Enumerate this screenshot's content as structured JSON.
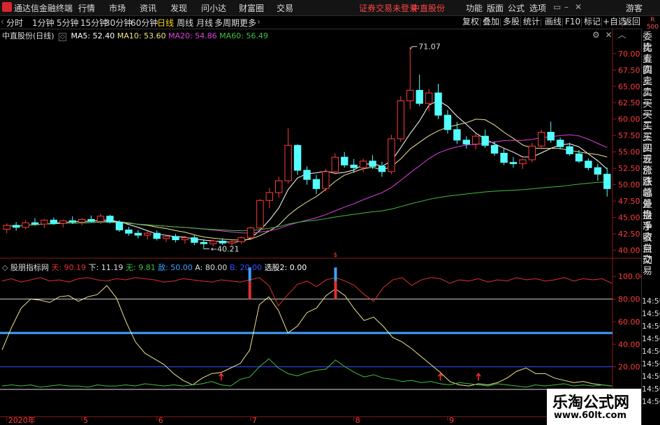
{
  "menubar": {
    "app_title": "通达信金融终端",
    "items": [
      "行情",
      "市场",
      "资讯",
      "发现",
      "问小达",
      "财富圈",
      "交易"
    ],
    "notice": "证券交易未登录",
    "stock_name": "中直股份",
    "right_items": [
      "功能",
      "版面",
      "公式",
      "选项"
    ],
    "guest": "游客"
  },
  "toolbar": {
    "periods": [
      "分时",
      "1分钟",
      "5分钟",
      "15分钟",
      "30分钟",
      "60分钟",
      "日线",
      "周线",
      "月线",
      "多周期",
      "更多"
    ],
    "active_period": "日线",
    "right_items": [
      "复权",
      "叠加",
      "多股",
      "统计",
      "画线",
      "F10",
      "标记",
      "+自选",
      "返回"
    ],
    "r_label": "R",
    "r_value": "500"
  },
  "main_legend": {
    "title": "中直股份(日线)",
    "ma": [
      {
        "label": "MA5: 52.40",
        "color": "#ffffff"
      },
      {
        "label": "MA10: 53.60",
        "color": "#f0e68c"
      },
      {
        "label": "MA20: 54.86",
        "color": "#e040e0"
      },
      {
        "label": "MA60: 56.49",
        "color": "#40c040"
      }
    ]
  },
  "sub_legend": {
    "title": "股朋指标网",
    "items": [
      {
        "label": "天: 90.19",
        "color": "#e03030"
      },
      {
        "label": "下: 11.19",
        "color": "#f0e68c"
      },
      {
        "label": "无: 9.81",
        "color": "#40c040"
      },
      {
        "label": "敌: 50.00",
        "color": "#40a0ff"
      },
      {
        "label": "A: 80.00",
        "color": "#dddddd"
      },
      {
        "label": "B: 20.00",
        "color": "#3050ff"
      },
      {
        "label": "选股2: 0.00",
        "color": "#ffffff"
      }
    ]
  },
  "sidebar": {
    "labels": [
      "委比",
      "卖五",
      "卖四",
      "卖三",
      "卖二",
      "卖一",
      "买一",
      "买二",
      "买三",
      "买四",
      "买五",
      "现价",
      "涨跌",
      "涨幅",
      "总量",
      "外盘",
      "换手",
      "净资",
      "收益",
      "自动",
      "交易"
    ],
    "times": [
      "14:56",
      "14:56",
      "14:56",
      "14:56",
      "14:56",
      "14:56",
      "14:56",
      "14:56",
      "14:56"
    ]
  },
  "chart_data": [
    {
      "type": "candlestick",
      "title": "中直股份(日线)",
      "ylim": [
        39,
        72
      ],
      "yticks": [
        "70.00",
        "67.50",
        "65.00",
        "62.50",
        "60.00",
        "57.50",
        "55.00",
        "52.50",
        "50.00",
        "47.50",
        "45.00",
        "42.50",
        "40.00"
      ],
      "annotations": [
        {
          "label": "71.07",
          "value": 71.07
        },
        {
          "label": "40.21",
          "value": 40.21
        }
      ],
      "candles": [
        [
          43.2,
          44.1,
          42.6,
          43.8
        ],
        [
          43.8,
          44.3,
          43.0,
          43.5
        ],
        [
          43.5,
          44.6,
          43.2,
          44.2
        ],
        [
          44.2,
          44.9,
          43.8,
          44.0
        ],
        [
          44.0,
          44.8,
          43.4,
          44.6
        ],
        [
          44.6,
          45.0,
          43.9,
          44.1
        ],
        [
          44.1,
          44.7,
          43.5,
          44.5
        ],
        [
          44.5,
          45.2,
          44.0,
          44.3
        ],
        [
          44.3,
          44.9,
          43.8,
          44.7
        ],
        [
          44.7,
          45.3,
          44.2,
          44.4
        ],
        [
          44.4,
          45.6,
          44.0,
          45.2
        ],
        [
          45.2,
          45.4,
          44.1,
          44.3
        ],
        [
          44.3,
          44.6,
          42.8,
          43.1
        ],
        [
          43.1,
          43.6,
          42.2,
          42.6
        ],
        [
          42.6,
          43.1,
          41.8,
          42.3
        ],
        [
          42.3,
          42.9,
          41.6,
          42.6
        ],
        [
          42.6,
          43.0,
          41.5,
          41.8
        ],
        [
          41.8,
          42.4,
          41.3,
          42.1
        ],
        [
          42.1,
          42.5,
          41.2,
          41.6
        ],
        [
          41.6,
          42.2,
          41.0,
          41.9
        ],
        [
          41.9,
          42.3,
          40.8,
          41.2
        ],
        [
          41.2,
          41.7,
          40.21,
          41.0
        ],
        [
          41.0,
          41.6,
          40.6,
          41.4
        ],
        [
          41.4,
          41.8,
          40.8,
          41.1
        ],
        [
          41.1,
          41.6,
          40.7,
          41.3
        ],
        [
          41.3,
          42.1,
          41.0,
          41.9
        ],
        [
          41.9,
          43.6,
          41.7,
          43.4
        ],
        [
          43.4,
          47.8,
          43.2,
          47.6
        ],
        [
          47.6,
          49.5,
          46.4,
          48.8
        ],
        [
          48.8,
          51.2,
          48.0,
          50.6
        ],
        [
          50.6,
          58.6,
          50.2,
          56.0
        ],
        [
          56.0,
          56.2,
          51.5,
          52.2
        ],
        [
          52.2,
          52.8,
          50.0,
          50.8
        ],
        [
          50.8,
          51.5,
          48.6,
          49.4
        ],
        [
          49.4,
          52.4,
          49.0,
          52.0
        ],
        [
          52.0,
          54.8,
          51.6,
          54.2
        ],
        [
          54.2,
          55.0,
          52.6,
          53.0
        ],
        [
          53.0,
          53.9,
          51.8,
          52.6
        ],
        [
          52.6,
          54.0,
          51.9,
          53.6
        ],
        [
          53.6,
          54.5,
          52.4,
          52.8
        ],
        [
          52.8,
          53.5,
          51.2,
          52.0
        ],
        [
          52.0,
          57.6,
          51.6,
          57.0
        ],
        [
          57.0,
          63.5,
          56.5,
          62.8
        ],
        [
          62.8,
          71.07,
          61.5,
          64.4
        ],
        [
          64.4,
          66.8,
          62.0,
          62.4
        ],
        [
          62.4,
          64.6,
          61.2,
          64.0
        ],
        [
          64.0,
          65.4,
          60.0,
          60.6
        ],
        [
          60.6,
          61.4,
          57.8,
          58.4
        ],
        [
          58.4,
          59.6,
          56.2,
          56.8
        ],
        [
          56.8,
          57.4,
          55.5,
          56.2
        ],
        [
          56.2,
          57.8,
          55.4,
          57.4
        ],
        [
          57.4,
          58.4,
          55.6,
          56.0
        ],
        [
          56.0,
          56.6,
          54.4,
          54.8
        ],
        [
          54.8,
          55.6,
          53.0,
          53.4
        ],
        [
          53.4,
          54.2,
          52.6,
          53.2
        ],
        [
          53.2,
          54.0,
          52.4,
          53.8
        ],
        [
          53.8,
          56.4,
          53.4,
          55.9
        ],
        [
          55.9,
          58.4,
          55.4,
          58.0
        ],
        [
          58.0,
          59.6,
          56.4,
          56.8
        ],
        [
          56.8,
          57.2,
          55.4,
          55.8
        ],
        [
          55.8,
          56.4,
          54.4,
          54.7
        ],
        [
          54.7,
          55.3,
          53.3,
          53.6
        ],
        [
          53.6,
          54.0,
          52.2,
          52.6
        ],
        [
          52.6,
          53.2,
          50.6,
          51.6
        ],
        [
          51.6,
          52.6,
          48.2,
          49.4
        ]
      ]
    },
    {
      "type": "line",
      "title": "股朋指标网",
      "ylim": [
        0,
        110
      ],
      "yticks": [
        "100.00",
        "80.00",
        "60.00",
        "40.00",
        "20.00"
      ],
      "hlines": [
        {
          "name": "敌",
          "value": 50
        },
        {
          "name": "A",
          "value": 80
        },
        {
          "name": "B",
          "value": 20
        },
        {
          "name": "base",
          "value": 0
        }
      ],
      "series": [
        {
          "name": "天",
          "values": [
            96,
            98,
            95,
            97,
            99,
            96,
            97,
            95,
            98,
            99,
            97,
            96,
            98,
            97,
            99,
            98,
            97,
            95,
            96,
            98,
            97,
            96,
            95,
            97,
            96,
            95,
            97,
            99,
            92,
            74,
            84,
            93,
            96,
            91,
            97,
            99,
            96,
            92,
            84,
            78,
            90,
            97,
            99,
            92,
            97,
            99,
            98,
            94,
            97,
            96,
            98,
            95,
            97,
            96,
            99,
            97,
            98,
            96,
            97,
            99,
            96,
            98,
            97,
            98,
            94
          ]
        },
        {
          "name": "下",
          "values": [
            35,
            55,
            72,
            80,
            79,
            77,
            82,
            83,
            78,
            82,
            84,
            92,
            81,
            60,
            42,
            32,
            27,
            22,
            14,
            8,
            4,
            10,
            14,
            15,
            19,
            23,
            35,
            75,
            82,
            70,
            50,
            56,
            68,
            72,
            83,
            89,
            83,
            71,
            61,
            64,
            56,
            46,
            42,
            36,
            29,
            22,
            15,
            7,
            4,
            3,
            5,
            4,
            6,
            10,
            16,
            19,
            14,
            14,
            10,
            8,
            6,
            7,
            5,
            4,
            3
          ]
        },
        {
          "name": "无",
          "values": [
            3,
            4,
            3,
            4,
            2,
            3,
            4,
            3,
            3,
            2,
            4,
            3,
            3,
            4,
            3,
            5,
            4,
            3,
            4,
            3,
            4,
            5,
            7,
            4,
            3,
            9,
            11,
            20,
            27,
            19,
            14,
            12,
            15,
            17,
            18,
            26,
            20,
            15,
            11,
            13,
            10,
            9,
            7,
            8,
            6,
            7,
            5,
            4,
            6,
            5,
            4,
            3,
            5,
            4,
            3,
            2,
            4,
            3,
            4,
            5,
            3,
            4,
            3,
            4,
            3
          ]
        }
      ],
      "markers": [
        {
          "type": "arrow",
          "index": 23
        },
        {
          "type": "arrow",
          "index": 46
        },
        {
          "type": "arrow",
          "index": 50
        },
        {
          "type": "signal",
          "index": 26
        },
        {
          "type": "signal",
          "index": 35
        }
      ]
    }
  ],
  "x_axis": {
    "labels": [
      {
        "text": "2020年",
        "index": 0
      },
      {
        "text": "5",
        "index": 8
      },
      {
        "text": "6",
        "index": 16
      },
      {
        "text": "7",
        "index": 26
      },
      {
        "text": "8",
        "index": 37
      },
      {
        "text": "9",
        "index": 47
      }
    ]
  },
  "colors": {
    "up": "#ff3b3b",
    "down": "#54ffff",
    "ma5": "#ffffff",
    "ma10": "#f0e68c",
    "ma20": "#e040e0",
    "ma60": "#40c040",
    "tian": "#e03030",
    "xia": "#f0e68c",
    "wu": "#40c040",
    "di": "#40a0ff",
    "A": "#cccccc",
    "B": "#3050ff",
    "arrow": "#ff3030"
  },
  "watermark": {
    "line1": "乐淘公式网",
    "line2": "www.60lt.com"
  }
}
